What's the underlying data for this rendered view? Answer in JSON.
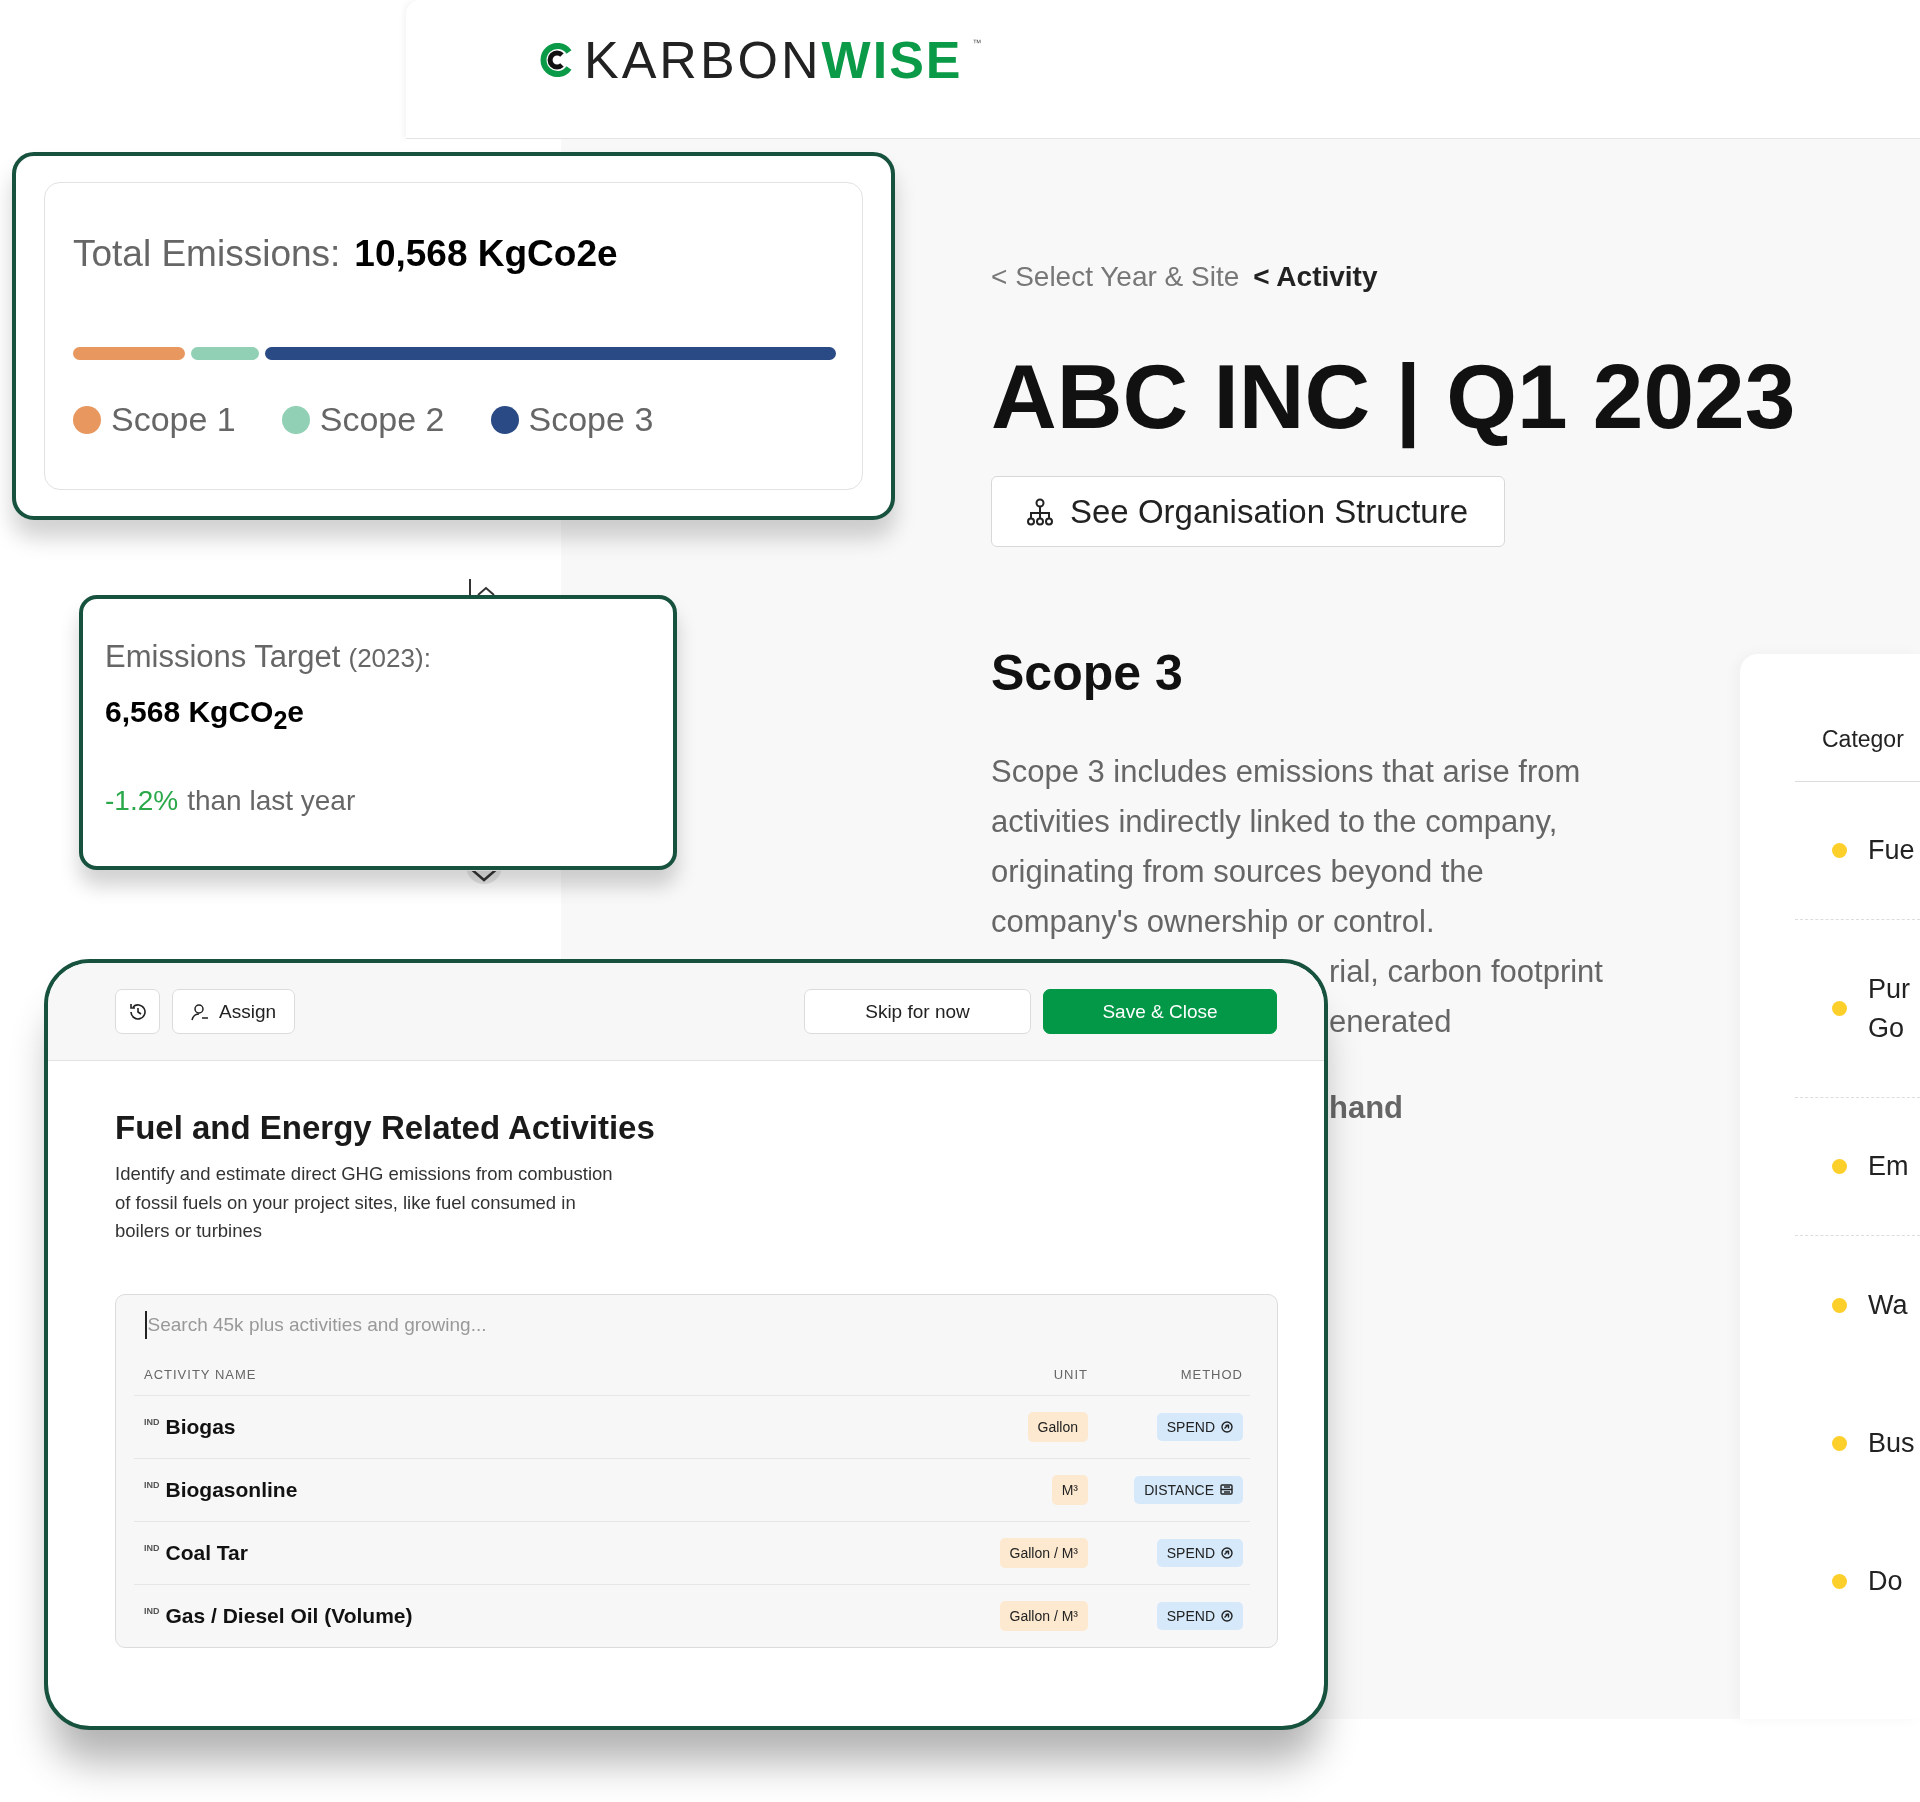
{
  "header": {
    "logo_light": "KARBON",
    "logo_bold": "WISE",
    "trademark": "™"
  },
  "breadcrumbs": [
    {
      "label": "< Select Year & Site",
      "selected": false
    },
    {
      "label": "< Activity",
      "selected": true
    }
  ],
  "title": "ABC INC | Q1 2023",
  "org_button": "See Organisation Structure",
  "scope_heading": "Scope 3",
  "scope_description": "Scope 3 includes emissions that arise from activities indirectly linked to the company, originating from sources beyond the company's ownership or control.",
  "covered_text_lines": [
    "rial, carbon footprint",
    "enerated"
  ],
  "covered_bold_text": "hand",
  "categories_panel": {
    "heading": "Categor",
    "items": [
      {
        "lines": [
          "Fue"
        ],
        "divider_below": true
      },
      {
        "lines": [
          "Pur",
          "Go"
        ],
        "divider_below": true
      },
      {
        "lines": [
          "Em"
        ],
        "divider_below": true
      },
      {
        "lines": [
          "Wa"
        ],
        "divider_below": false
      },
      {
        "lines": [
          "Bus"
        ],
        "divider_below": false
      },
      {
        "lines": [
          "Do"
        ],
        "divider_below": false
      }
    ]
  },
  "total_card": {
    "label": "Total Emissions:",
    "value": "10,568 KgCo2e",
    "scopes": [
      {
        "name": "Scope 1",
        "color": "#e8985f"
      },
      {
        "name": "Scope 2",
        "color": "#92d0b5"
      },
      {
        "name": "Scope 3",
        "color": "#294a84"
      }
    ]
  },
  "target_card": {
    "label": "Emissions Target",
    "year": "(2023):",
    "value": "6,568 KgCO$_{2}$e",
    "change": "-1.2%",
    "change_text": "than last year"
  },
  "modal": {
    "assign_button": "Assign",
    "skip_button": "Skip for now",
    "save_button": "Save & Close",
    "title": "Fuel and Energy Related Activities",
    "description": "Identify and estimate direct GHG emissions from combustion of fossil fuels on your project sites, like fuel consumed in boilers or turbines",
    "search": {
      "placeholder": "Search 45k plus activities and growing..."
    },
    "columns": [
      "ACTIVITY NAME",
      "UNIT",
      "METHOD"
    ],
    "rows": [
      {
        "tag": "IND",
        "name": "Biogas",
        "unit": "Gallon",
        "method": "SPEND",
        "kind": "spend"
      },
      {
        "tag": "IND",
        "name": "Biogasonline",
        "unit": "M³",
        "method": "DISTANCE",
        "kind": "distance"
      },
      {
        "tag": "IND",
        "name": "Coal Tar",
        "unit": "Gallon / M³",
        "method": "SPEND",
        "kind": "spend"
      },
      {
        "tag": "IND",
        "name": "Gas / Diesel Oil (Volume)",
        "unit": "Gallon / M³",
        "method": "SPEND",
        "kind": "spend"
      }
    ]
  }
}
